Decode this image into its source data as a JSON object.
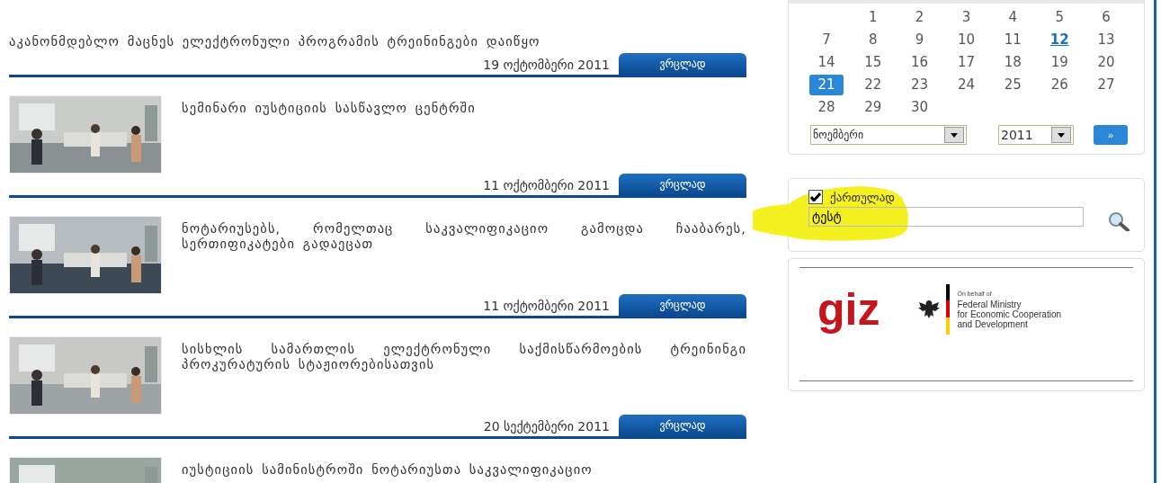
{
  "news": [
    {
      "title": "აკანონმდებლო მაცნეს ელექტრონული პროგრამის ტრეინინგები დაიწყო",
      "date": "19 ოქტომბერი 2011",
      "more": "ვრცლად"
    },
    {
      "title": "სემინარი იუსტიციის სასწავლო ცენტრში",
      "date": "11 ოქტომბერი 2011",
      "more": "ვრცლად"
    },
    {
      "title": "ნოტარიუსებს, რომელთაც საკვალიფიკაციო გამოცდა ჩააბარეს, სერთიფიკატები გადაეცათ",
      "date": "11 ოქტომბერი 2011",
      "more": "ვრცლად"
    },
    {
      "title": "სისხლის სამართლის ელექტრონული საქმისწარმოების ტრეინინგი პროკურატურის სტაჟიორებისათვის",
      "date": "20 სექტემბერი 2011",
      "more": "ვრცლად"
    },
    {
      "title": "იუსტიციის სამინისტროში ნოტარიუსთა საკვალიფიკაციო"
    }
  ],
  "calendar": {
    "days": [
      {
        "label": "1",
        "selected": false,
        "today": false
      },
      {
        "label": "2",
        "selected": false,
        "today": false
      },
      {
        "label": "3",
        "selected": false,
        "today": false
      },
      {
        "label": "4",
        "selected": false,
        "today": false
      },
      {
        "label": "5",
        "selected": false,
        "today": false
      },
      {
        "label": "6",
        "selected": false,
        "today": false
      },
      {
        "label": "7",
        "selected": false,
        "today": false
      },
      {
        "label": "8",
        "selected": false,
        "today": false
      },
      {
        "label": "9",
        "selected": false,
        "today": false
      },
      {
        "label": "10",
        "selected": false,
        "today": false
      },
      {
        "label": "11",
        "selected": false,
        "today": false
      },
      {
        "label": "12",
        "selected": false,
        "today": true
      },
      {
        "label": "13",
        "selected": false,
        "today": false
      },
      {
        "label": "14",
        "selected": false,
        "today": false
      },
      {
        "label": "15",
        "selected": false,
        "today": false
      },
      {
        "label": "16",
        "selected": false,
        "today": false
      },
      {
        "label": "17",
        "selected": false,
        "today": false
      },
      {
        "label": "18",
        "selected": false,
        "today": false
      },
      {
        "label": "19",
        "selected": false,
        "today": false
      },
      {
        "label": "20",
        "selected": false,
        "today": false
      },
      {
        "label": "21",
        "selected": true,
        "today": false
      },
      {
        "label": "22",
        "selected": false,
        "today": false
      },
      {
        "label": "23",
        "selected": false,
        "today": false
      },
      {
        "label": "24",
        "selected": false,
        "today": false
      },
      {
        "label": "25",
        "selected": false,
        "today": false
      },
      {
        "label": "26",
        "selected": false,
        "today": false
      },
      {
        "label": "27",
        "selected": false,
        "today": false
      },
      {
        "label": "28",
        "selected": false,
        "today": false
      },
      {
        "label": "29",
        "selected": false,
        "today": false
      },
      {
        "label": "30",
        "selected": false,
        "today": false
      }
    ],
    "month": "ნოემბერი",
    "year": "2011",
    "next": "»"
  },
  "search": {
    "checkbox_label": "ქართულად",
    "checked": true,
    "value": "ტესტ"
  },
  "partners": {
    "giz": "giz",
    "on_behalf": "On behalf of",
    "ministry": [
      "Federal Ministry",
      "for Economic Cooperation",
      "and Development"
    ]
  }
}
